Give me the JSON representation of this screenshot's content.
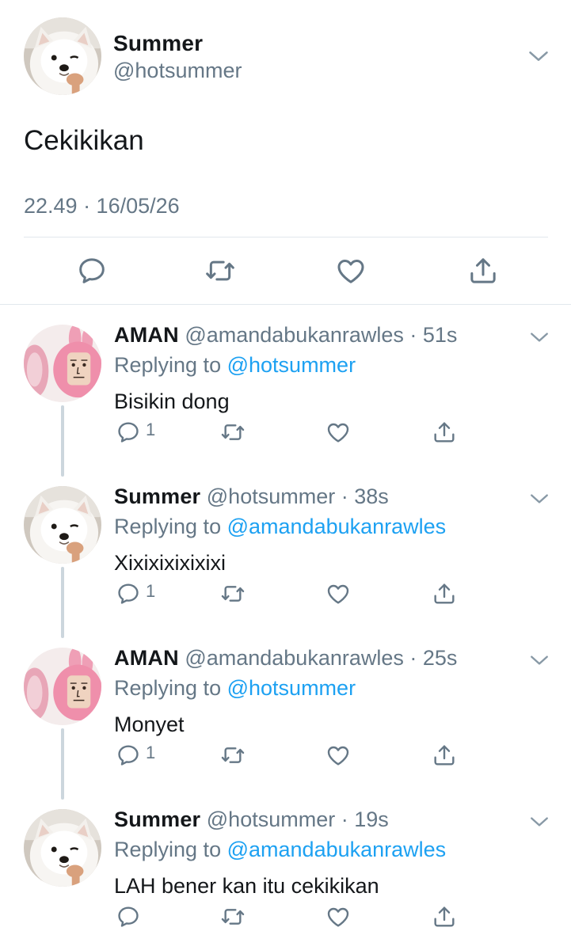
{
  "colors": {
    "text_primary": "#14171a",
    "text_secondary": "#657786",
    "link": "#1da1f2",
    "divider": "#e1e8ed",
    "thread_line": "#ccd6dd"
  },
  "main_tweet": {
    "author": {
      "name": "Summer",
      "handle": "@hotsummer",
      "avatar": "samoyed-dog-avatar"
    },
    "text": "Cekikikan",
    "meta": "22.49 · 16/05/26",
    "actions": [
      "reply-icon",
      "retweet-icon",
      "like-icon",
      "share-icon"
    ]
  },
  "replies": [
    {
      "name": "AMAN",
      "handle": "@amandabukanrawles",
      "time": "· 51s",
      "replying_prefix": "Replying to",
      "replying_to": "@hotsummer",
      "text": "Bisikin dong",
      "reply_count": "1",
      "avatar": "pink-plush-avatar"
    },
    {
      "name": "Summer",
      "handle": "@hotsummer",
      "time": "· 38s",
      "replying_prefix": "Replying to",
      "replying_to": "@amandabukanrawles",
      "text": "Xixixixixixixi",
      "reply_count": "1",
      "avatar": "samoyed-dog-avatar"
    },
    {
      "name": "AMAN",
      "handle": "@amandabukanrawles",
      "time": "· 25s",
      "replying_prefix": "Replying to",
      "replying_to": "@hotsummer",
      "text": "Monyet",
      "reply_count": "1",
      "avatar": "pink-plush-avatar"
    },
    {
      "name": "Summer",
      "handle": "@hotsummer",
      "time": "· 19s",
      "replying_prefix": "Replying to",
      "replying_to": "@amandabukanrawles",
      "text": "LAH bener kan itu cekikikan",
      "reply_count": "",
      "avatar": "samoyed-dog-avatar"
    }
  ]
}
